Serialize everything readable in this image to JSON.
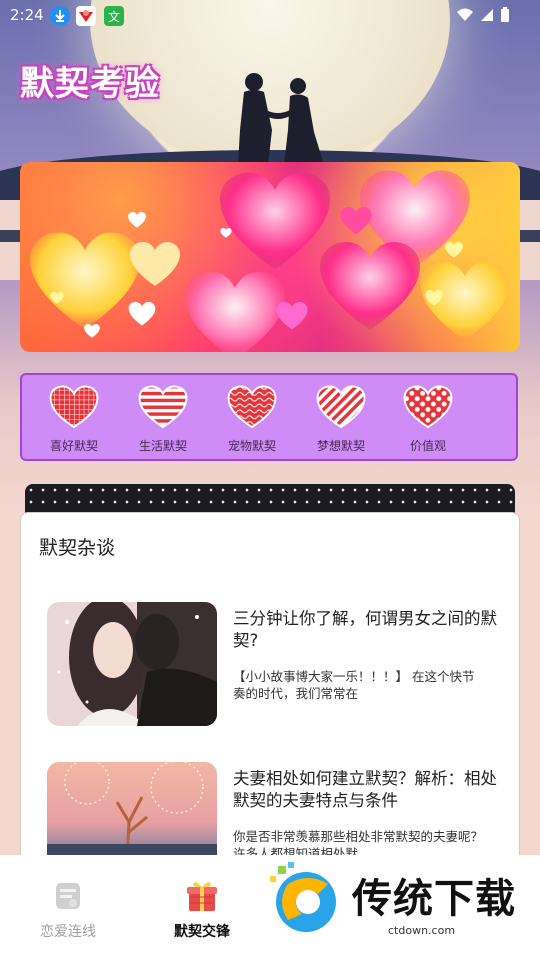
{
  "status_bar": {
    "time": "2:24",
    "icons": [
      "download-icon",
      "app-icon",
      "app-icon",
      "wifi-icon",
      "signal-icon",
      "battery-icon"
    ]
  },
  "app_title": "默契考验",
  "categories": [
    {
      "label": "喜好默契",
      "icon": "grid-heart-icon",
      "pattern": "grid"
    },
    {
      "label": "生活默契",
      "icon": "stripe-heart-icon",
      "pattern": "hstripe"
    },
    {
      "label": "宠物默契",
      "icon": "wave-heart-icon",
      "pattern": "wave"
    },
    {
      "label": "梦想默契",
      "icon": "diagonal-heart-icon",
      "pattern": "diag"
    },
    {
      "label": "价值观",
      "icon": "dot-heart-icon",
      "pattern": "dots"
    }
  ],
  "section": {
    "title": "默契杂谈",
    "articles": [
      {
        "title": "三分钟让你了解，何谓男女之间的默契?",
        "desc": "【小小故事博大家一乐！！！】 在这个快节奏的时代，我们常常在"
      },
      {
        "title": "夫妻相处如何建立默契？解析：相处默契的夫妻特点与条件",
        "desc": "你是否非常羡慕那些相处非常默契的夫妻呢？许多人都想知道相处默"
      }
    ]
  },
  "bottom_nav": [
    {
      "label": "恋爱连线",
      "active": false
    },
    {
      "label": "默契交锋",
      "active": true
    }
  ],
  "watermark": {
    "brand": "传统下载",
    "url": "ctdown.com"
  },
  "colors": {
    "accent_purple": "#cf8bf6",
    "heart_red": "#e6343a",
    "title_glow": "#c743c0"
  }
}
